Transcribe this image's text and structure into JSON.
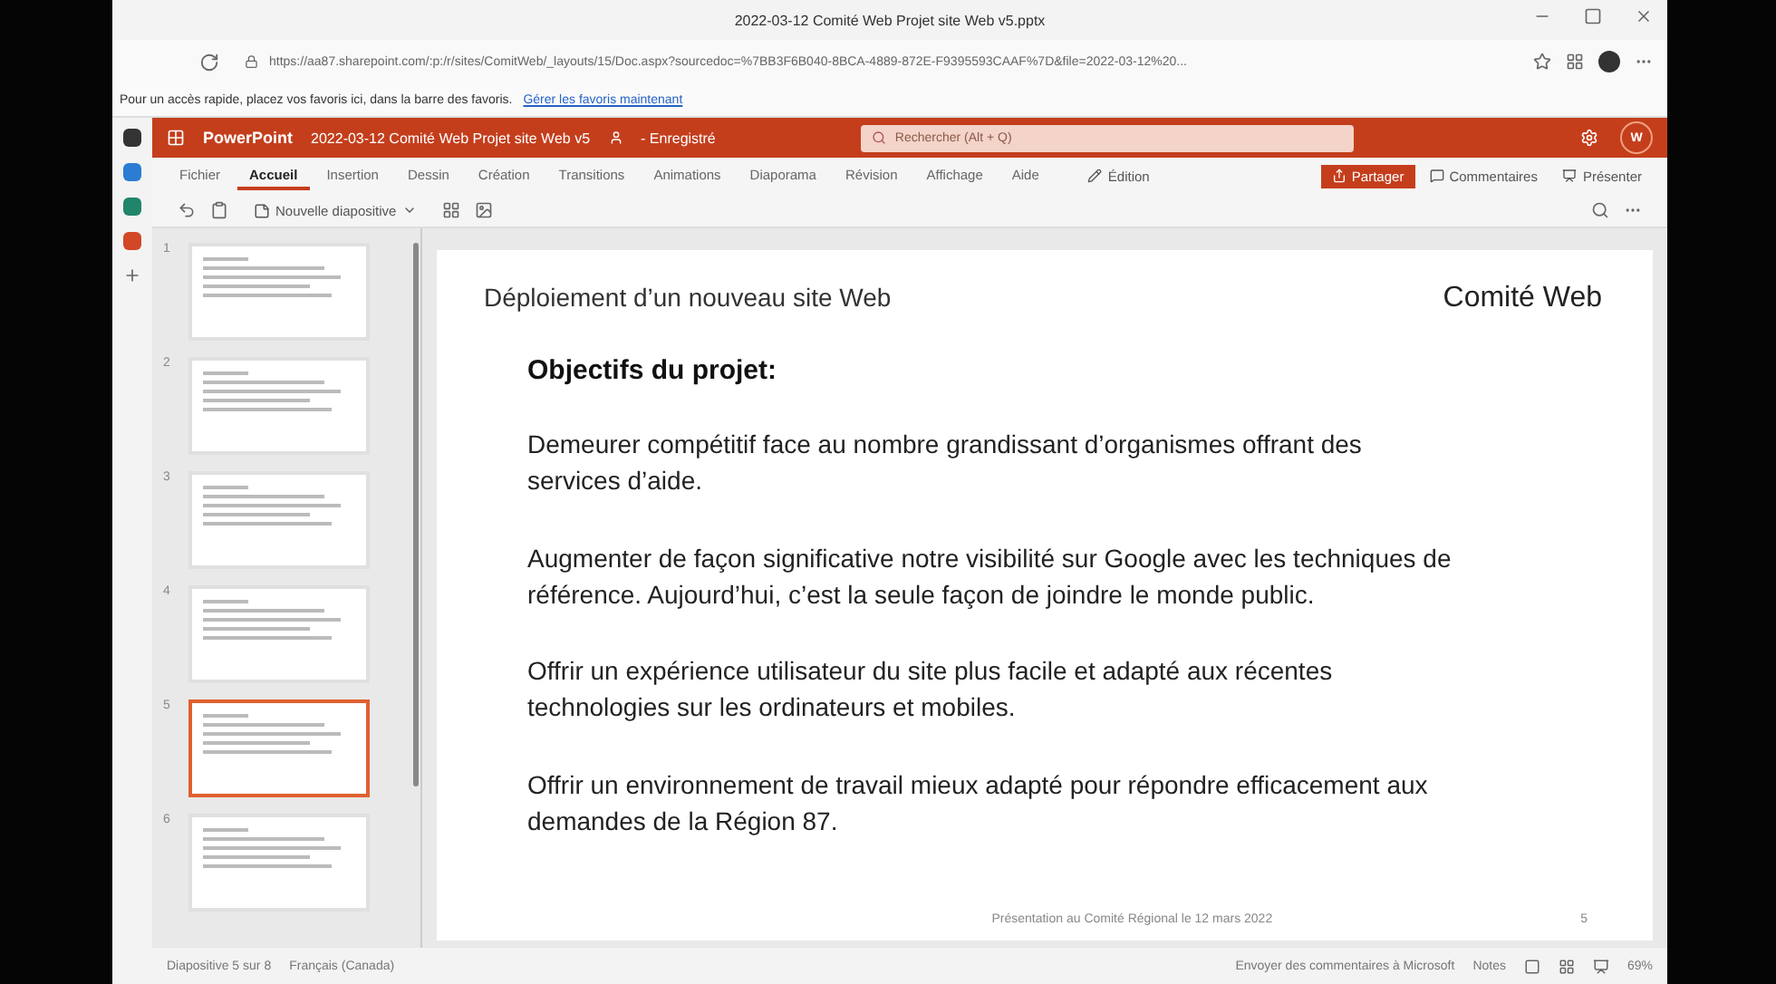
{
  "browser": {
    "tab_title": "2022-03-12 Comité Web Projet site Web v5.pptx",
    "url": "https://aa87.sharepoint.com/:p:/r/sites/ComitWeb/_layouts/15/Doc.aspx?sourcedoc=%7BB3F6B040-8BCA-4889-872E-F9395593CAAF%7D&file=2022-03-12%20...",
    "favorites_prompt": "Pour un accès rapide, placez vos favoris ici, dans la barre des favoris.",
    "favorites_link": "Gérer les favoris maintenant"
  },
  "app": {
    "name": "PowerPoint",
    "doc_title": "2022-03-12 Comité Web Projet site Web v5",
    "save_state": "- Enregistré",
    "search_placeholder": "Rechercher (Alt + Q)",
    "user_initial": "W"
  },
  "ribbon_tabs": [
    {
      "label": "Fichier",
      "selected": false
    },
    {
      "label": "Accueil",
      "selected": true
    },
    {
      "label": "Insertion",
      "selected": false
    },
    {
      "label": "Dessin",
      "selected": false
    },
    {
      "label": "Création",
      "selected": false
    },
    {
      "label": "Transitions",
      "selected": false
    },
    {
      "label": "Animations",
      "selected": false
    },
    {
      "label": "Diaporama",
      "selected": false
    },
    {
      "label": "Révision",
      "selected": false
    },
    {
      "label": "Affichage",
      "selected": false
    },
    {
      "label": "Aide",
      "selected": false
    }
  ],
  "ribbon_actions": {
    "editing": "Édition",
    "share": "Partager",
    "comments": "Commentaires",
    "present": "Présenter"
  },
  "toolbar": {
    "new_slide": "Nouvelle diapositive"
  },
  "thumbnails": [
    {
      "number": "1",
      "selected": false
    },
    {
      "number": "2",
      "selected": false
    },
    {
      "number": "3",
      "selected": false
    },
    {
      "number": "4",
      "selected": false
    },
    {
      "number": "5",
      "selected": true
    },
    {
      "number": "6",
      "selected": false
    }
  ],
  "slide": {
    "header_left": "Déploiement d’un nouveau site Web",
    "header_right": "Comité Web",
    "heading": "Objectifs du projet:",
    "paragraphs": [
      "Demeurer compétitif face au nombre grandissant d’organismes offrant des services d’aide.",
      "Augmenter de façon significative notre visibilité sur Google avec les techniques de référence. Aujourd’hui, c’est la seule façon de joindre le monde public.",
      "Offrir un expérience utilisateur du site plus facile et adapté aux récentes technologies sur les ordinateurs et mobiles.",
      "Offrir un environnement de travail mieux adapté pour répondre efficacement aux demandes de la Région 87."
    ],
    "footer": "Présentation au Comité Régional le 12 mars 2022",
    "page_number": "5"
  },
  "status_bar": {
    "slide_info": "Diapositive 5 sur 8",
    "language": "Français (Canada)",
    "feedback": "Envoyer des commentaires à Microsoft",
    "notes": "Notes",
    "zoom": "69%"
  }
}
